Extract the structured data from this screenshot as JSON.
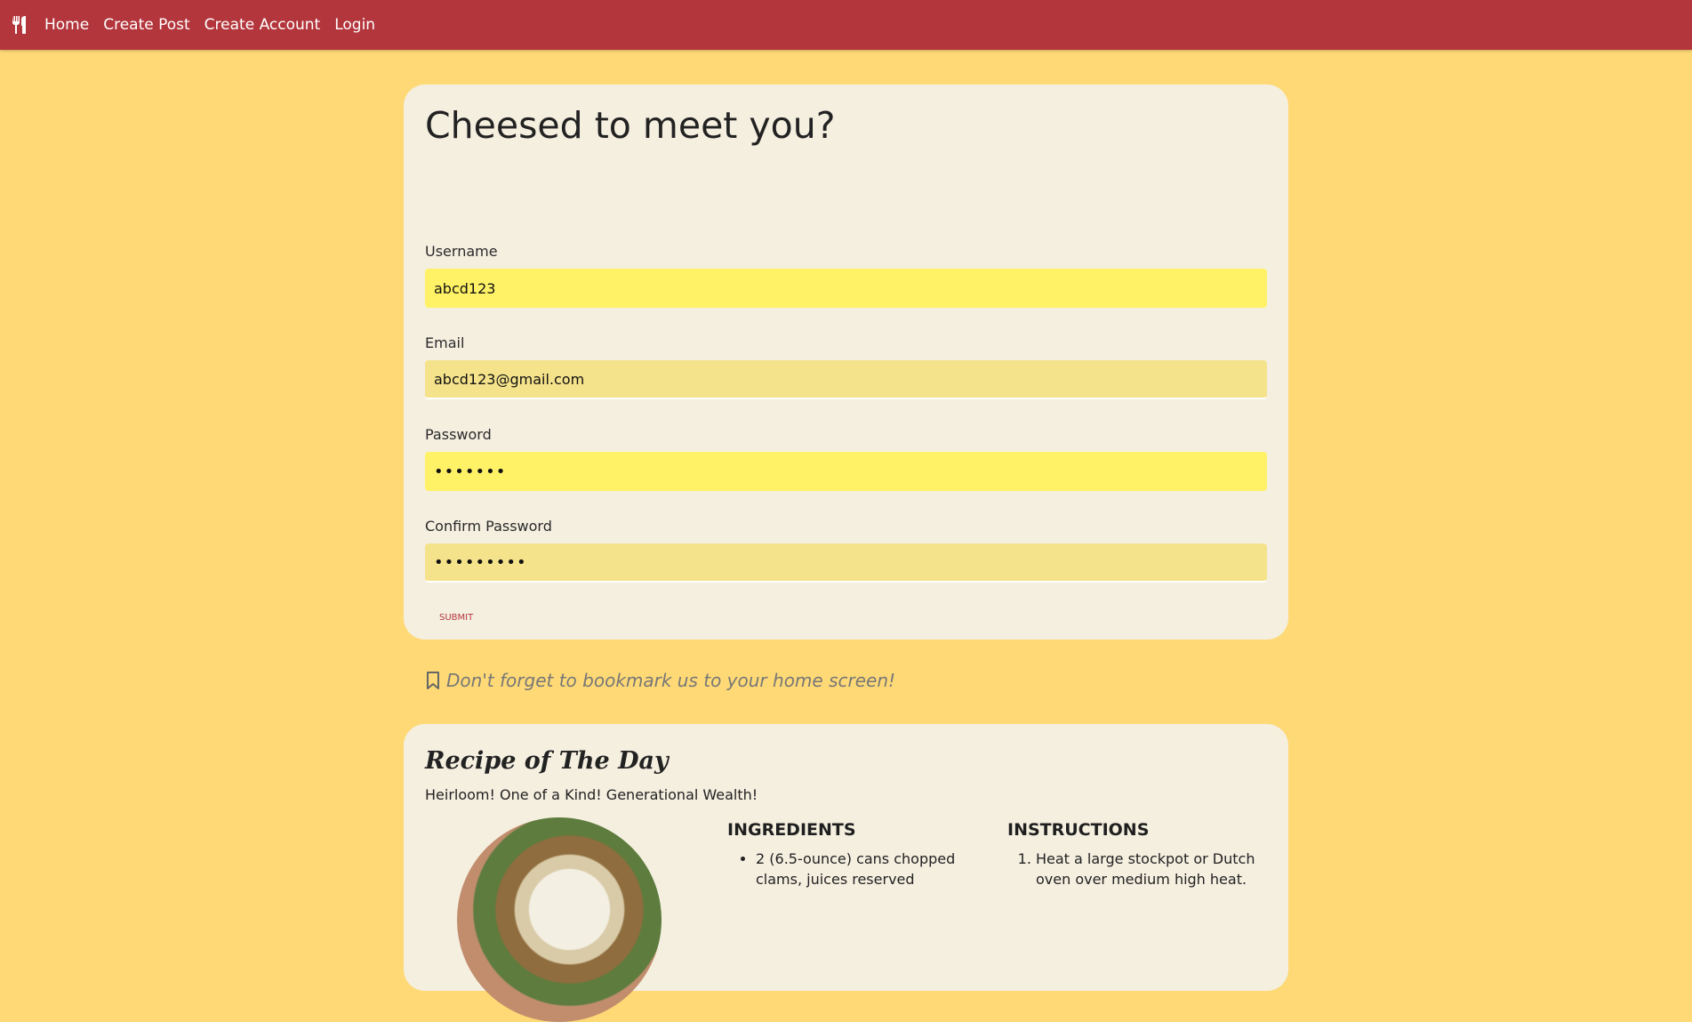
{
  "nav": {
    "logo_icon": "utensils-icon",
    "links": [
      "Home",
      "Create Post",
      "Create Account",
      "Login"
    ]
  },
  "signup_form": {
    "title": "Cheesed to meet you?",
    "username_label": "Username",
    "username_value": "abcd123",
    "email_label": "Email",
    "email_value": "abcd123@gmail.com",
    "password_label": "Password",
    "password_value": "•••••••",
    "confirm_label": "Confirm Password",
    "confirm_value": "•••••••••",
    "submit_label": "SUBMIT",
    "bookmark_text": "Don't forget to bookmark us to your home screen!"
  },
  "recipe": {
    "title": "Recipe of The Day",
    "subtitle": "Heirloom! One of a Kind! Generational Wealth!",
    "ingredients_heading": "INGREDIENTS",
    "ingredients": [
      "2 (6.5-ounce) cans chopped clams, juices reserved"
    ],
    "instructions_heading": "INSTRUCTIONS",
    "instructions": [
      "Heat a large stockpot or Dutch oven over medium high heat."
    ]
  },
  "colors": {
    "navbar": "#b3363c",
    "page_background": "#fed976",
    "card": "#f5efe0",
    "input_highlight": "#fff266",
    "input_muted": "#f5e38b"
  }
}
